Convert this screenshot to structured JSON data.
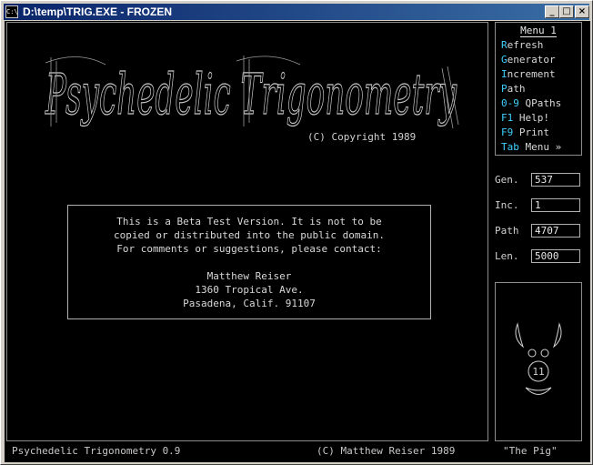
{
  "window": {
    "title": "D:\\temp\\TRIG.EXE - FROZEN",
    "sysicon": "C:\\",
    "minimize_glyph": "_",
    "maximize_glyph": "□",
    "close_glyph": "×"
  },
  "logo": {
    "text": "Psychedelic Trigonometry"
  },
  "copyright": "(C) Copyright 1989",
  "notice": {
    "lines": [
      "This is a Beta Test Version.  It is not to be",
      "copied or distributed into the public domain.",
      "For comments or suggestions, please contact:",
      "",
      "Matthew Reiser",
      "1360 Tropical Ave.",
      "Pasadena, Calif. 91107"
    ]
  },
  "menu": {
    "title": "Menu 1",
    "items": [
      {
        "key": "R",
        "rest": "efresh"
      },
      {
        "key": "G",
        "rest": "enerator"
      },
      {
        "key": "I",
        "rest": "ncrement"
      },
      {
        "key": "P",
        "rest": "ath"
      },
      {
        "key": "0-9",
        "rest": " QPaths"
      },
      {
        "key": "F1",
        "rest": " Help!"
      },
      {
        "key": "F9",
        "rest": " Print"
      },
      {
        "key": "Tab",
        "rest": " Menu »"
      }
    ]
  },
  "stats": {
    "gen": {
      "label": "Gen.",
      "value": "537"
    },
    "inc": {
      "label": "Inc.",
      "value": "1"
    },
    "path": {
      "label": "Path",
      "value": "4707"
    },
    "len": {
      "label": "Len.",
      "value": "5000"
    }
  },
  "pig": {
    "nose": "11"
  },
  "status": {
    "left": "Psychedelic Trigonometry 0.9",
    "middle": "(C) Matthew Reiser 1989",
    "right": "\"The Pig\""
  },
  "colors": {
    "title_bar": "#0a246a",
    "menu_key": "#40d0ff",
    "border": "#8c8c8c",
    "text": "#d8d8d8"
  }
}
